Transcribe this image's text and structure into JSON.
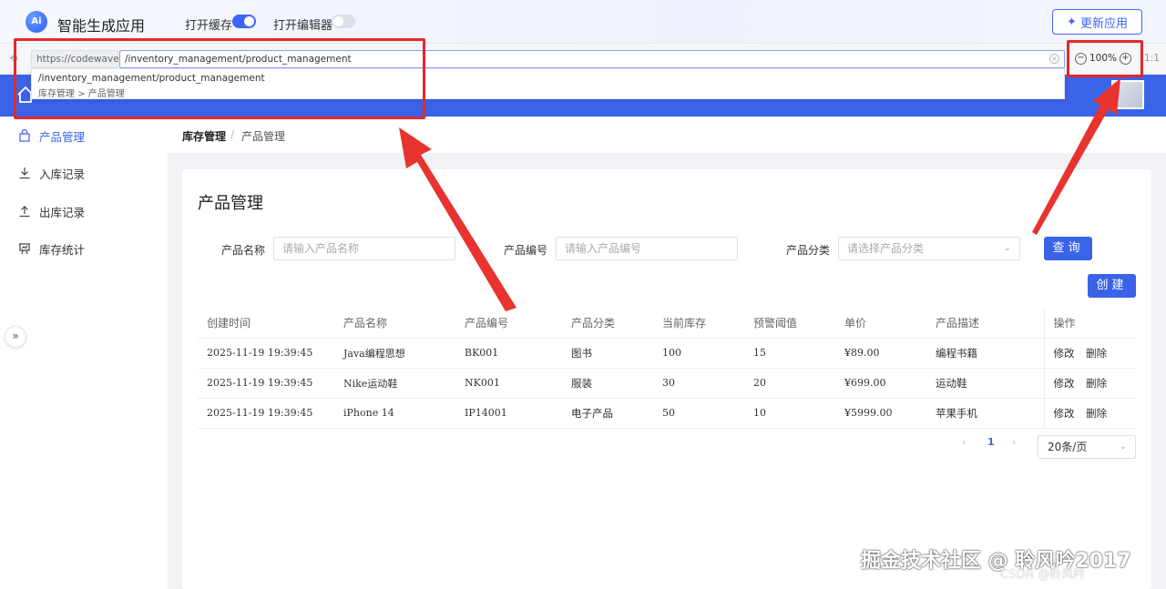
{
  "app": {
    "logo_text": "Ai",
    "title": "智能生成应用",
    "update_button": "更新应用"
  },
  "toggles": [
    {
      "label": "打开缓存",
      "on": true
    },
    {
      "label": "打开编辑器",
      "on": false
    }
  ],
  "urlbar": {
    "domain": "https://codewave.ai",
    "path": "/inventory_management/product_management",
    "zoom": "100%",
    "ratio": "1:1"
  },
  "suggestion": {
    "path": "/inventory_management/product_management",
    "crumb": "库存管理 > 产品管理"
  },
  "sidebar": {
    "items": [
      {
        "label": "产品管理",
        "icon": "bag-icon",
        "active": true
      },
      {
        "label": "入库记录",
        "icon": "download-icon",
        "active": false
      },
      {
        "label": "出库记录",
        "icon": "upload-icon",
        "active": false
      },
      {
        "label": "库存统计",
        "icon": "chart-board-icon",
        "active": false
      }
    ]
  },
  "breadcrumb": {
    "parent": "库存管理",
    "separator": "/",
    "current": "产品管理"
  },
  "page": {
    "title": "产品管理",
    "filters": [
      {
        "label": "产品名称",
        "placeholder": "请输入产品名称"
      },
      {
        "label": "产品编号",
        "placeholder": "请输入产品编号"
      },
      {
        "label": "产品分类",
        "placeholder": "请选择产品分类"
      }
    ],
    "search_button": "查询",
    "create_button": "创建"
  },
  "table": {
    "headers": [
      "创建时间",
      "产品名称",
      "产品编号",
      "产品分类",
      "当前库存",
      "预警阈值",
      "单价",
      "产品描述",
      "操作"
    ],
    "rows": [
      [
        "2025-11-19 19:39:45",
        "Java编程思想",
        "BK001",
        "图书",
        "100",
        "15",
        "¥89.00",
        "编程书籍"
      ],
      [
        "2025-11-19 19:39:45",
        "Nike运动鞋",
        "NK001",
        "服装",
        "30",
        "20",
        "¥699.00",
        "运动鞋"
      ],
      [
        "2025-11-19 19:39:45",
        "iPhone 14",
        "IP14001",
        "电子产品",
        "50",
        "10",
        "¥5999.00",
        "苹果手机"
      ]
    ],
    "actions": {
      "edit": "修改",
      "delete": "删除"
    }
  },
  "pagination": {
    "prev": "‹",
    "current": "1",
    "next": "›",
    "page_size": "20条/页"
  },
  "watermark": {
    "main": "掘金技术社区 @ 聆风吟2017",
    "sub": "CSDN @聆风吟"
  },
  "colors": {
    "primary": "#3a63e8",
    "annotation": "#e3282b"
  }
}
